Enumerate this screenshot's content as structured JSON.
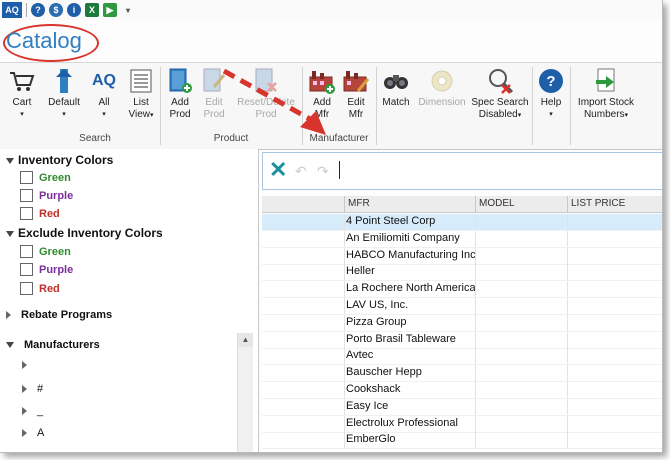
{
  "quick_access": {
    "logo": "AQ",
    "icons": [
      "help-icon",
      "dollar-icon",
      "info-icon",
      "excel-icon",
      "export-icon",
      "dropdown-icon"
    ]
  },
  "tab": {
    "label": "Catalog"
  },
  "ribbon": {
    "search_group": {
      "label": "Search",
      "buttons": [
        {
          "label1": "Cart",
          "label2": "",
          "dropdown": true
        },
        {
          "label1": "Default",
          "label2": "",
          "dropdown": true
        },
        {
          "label1": "All",
          "label2": "",
          "dropdown": true
        },
        {
          "label1": "List",
          "label2": "View",
          "dropdown": true
        }
      ]
    },
    "product_group": {
      "label": "Product",
      "buttons": [
        {
          "label1": "Add",
          "label2": "Prod",
          "disabled": false
        },
        {
          "label1": "Edit",
          "label2": "Prod",
          "disabled": true
        },
        {
          "label1": "Reset/Delete",
          "label2": "Prod",
          "disabled": true
        }
      ]
    },
    "manufacturer_group": {
      "label": "Manufacturer",
      "buttons": [
        {
          "label1": "Add",
          "label2": "Mfr"
        },
        {
          "label1": "Edit",
          "label2": "Mfr"
        }
      ]
    },
    "other_buttons": [
      {
        "label1": "Match",
        "label2": "",
        "disabled": false
      },
      {
        "label1": "Dimension",
        "label2": "",
        "disabled": true
      },
      {
        "label1": "Spec Search",
        "label2": "Disabled",
        "dropdown": true
      },
      {
        "label1": "Help",
        "label2": "",
        "dropdown": true
      },
      {
        "label1": "Import Stock",
        "label2": "Numbers",
        "dropdown": true
      }
    ]
  },
  "filters": {
    "inventory_colors": {
      "title": "Inventory Colors",
      "options": [
        "Green",
        "Purple",
        "Red"
      ]
    },
    "exclude_inventory_colors": {
      "title": "Exclude Inventory Colors",
      "options": [
        "Green",
        "Purple",
        "Red"
      ]
    },
    "rebate_programs": {
      "title": "Rebate Programs"
    },
    "manufacturers": {
      "title": "Manufacturers",
      "nodes": [
        "",
        "#",
        "_",
        "A"
      ]
    }
  },
  "grid": {
    "columns": [
      "MFR",
      "MODEL",
      "LIST PRICE"
    ],
    "rows": [
      "4 Point Steel Corp",
      "An Emiliomiti Company",
      "HABCO Manufacturing Inc",
      "Heller",
      "La Rochere North America",
      "LAV US, Inc.",
      "Pizza Group",
      "Porto Brasil Tableware",
      "Avtec",
      "Bauscher Hepp",
      "Cookshack",
      "Easy Ice",
      "Electrolux Professional",
      "EmberGlo"
    ]
  },
  "colors": {
    "accent": "#2f7fc1",
    "highlight": "#d9342b",
    "selected_row": "#d7ecfb"
  }
}
